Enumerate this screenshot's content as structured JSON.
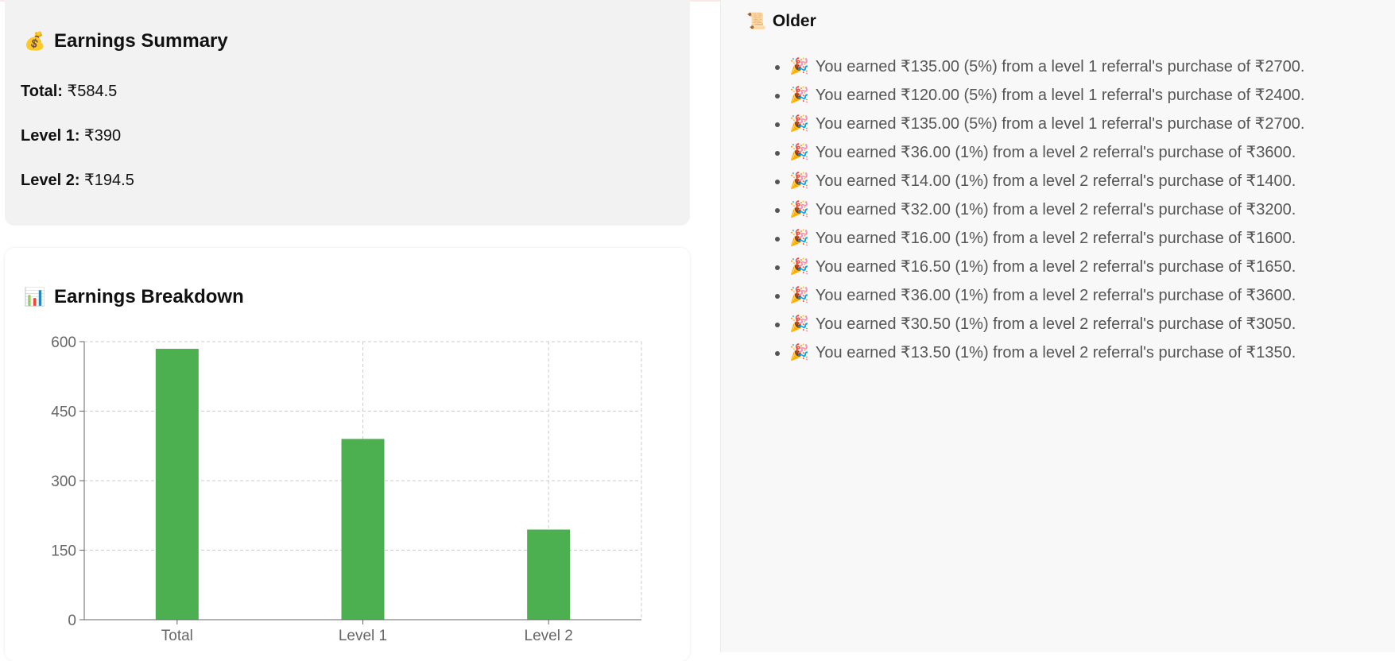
{
  "summary": {
    "icon": "money-bag-icon",
    "emoji": "💰",
    "title": "Earnings Summary",
    "total_label": "Total:",
    "total_value": "₹584.5",
    "level1_label": "Level 1:",
    "level1_value": "₹390",
    "level2_label": "Level 2:",
    "level2_value": "₹194.5"
  },
  "breakdown": {
    "icon": "bar-chart-icon",
    "emoji": "📊",
    "title": "Earnings Breakdown"
  },
  "chart_data": {
    "type": "bar",
    "categories": [
      "Total",
      "Level 1",
      "Level 2"
    ],
    "values": [
      584.5,
      390,
      194.5
    ],
    "yticks": [
      0,
      150,
      300,
      450,
      600
    ],
    "ylim": [
      0,
      600
    ],
    "grid": true,
    "bar_color": "#4caf50",
    "title": "",
    "xlabel": "",
    "ylabel": ""
  },
  "history": {
    "icon": "scroll-icon",
    "emoji": "📜",
    "title": "Older",
    "item_emoji": "🎉",
    "items": [
      "You earned ₹135.00 (5%) from a level 1 referral's purchase of ₹2700.",
      "You earned ₹120.00 (5%) from a level 1 referral's purchase of ₹2400.",
      "You earned ₹135.00 (5%) from a level 1 referral's purchase of ₹2700.",
      "You earned ₹36.00 (1%) from a level 2 referral's purchase of ₹3600.",
      "You earned ₹14.00 (1%) from a level 2 referral's purchase of ₹1400.",
      "You earned ₹32.00 (1%) from a level 2 referral's purchase of ₹3200.",
      "You earned ₹16.00 (1%) from a level 2 referral's purchase of ₹1600.",
      "You earned ₹16.50 (1%) from a level 2 referral's purchase of ₹1650.",
      "You earned ₹36.00 (1%) from a level 2 referral's purchase of ₹3600.",
      "You earned ₹30.50 (1%) from a level 2 referral's purchase of ₹3050.",
      "You earned ₹13.50 (1%) from a level 2 referral's purchase of ₹1350."
    ]
  }
}
